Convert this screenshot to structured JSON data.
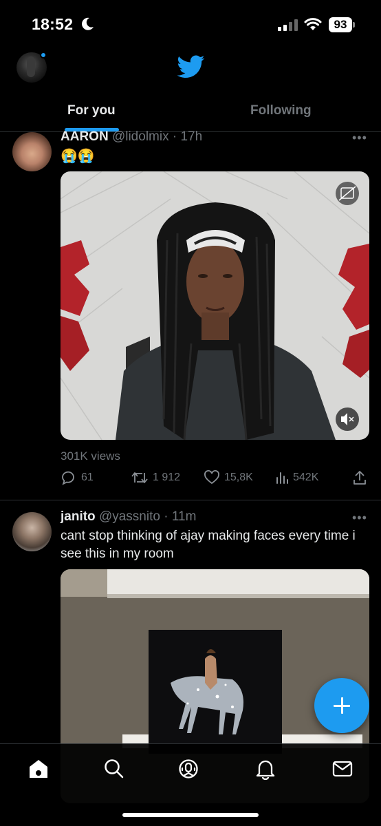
{
  "status_bar": {
    "time": "18:52",
    "battery": "93",
    "icons": [
      "moon-icon",
      "cellular-signal-icon",
      "wifi-icon",
      "battery-icon"
    ]
  },
  "header": {
    "logo_icon": "twitter-bird-icon",
    "accent_color": "#1d9bf0"
  },
  "tabs": [
    {
      "label": "For you",
      "selected": true
    },
    {
      "label": "Following",
      "selected": false
    }
  ],
  "tweets": [
    {
      "name": "AARON",
      "handle": "@lidolmix",
      "time": "· 17h",
      "text": "😭😭",
      "views": "301K views",
      "replies": "61",
      "retweets": "1 912",
      "likes": "15,8K",
      "analytics": "542K"
    },
    {
      "name": "janito",
      "handle": "@yassnito",
      "time": "· 11m",
      "text": "cant stop thinking of ajay making faces every time i see this in my room"
    }
  ],
  "bottom_nav": [
    "home-icon",
    "search-icon",
    "spaces-icon",
    "notifications-icon",
    "messages-icon"
  ],
  "fab_icon": "compose-plus-icon"
}
